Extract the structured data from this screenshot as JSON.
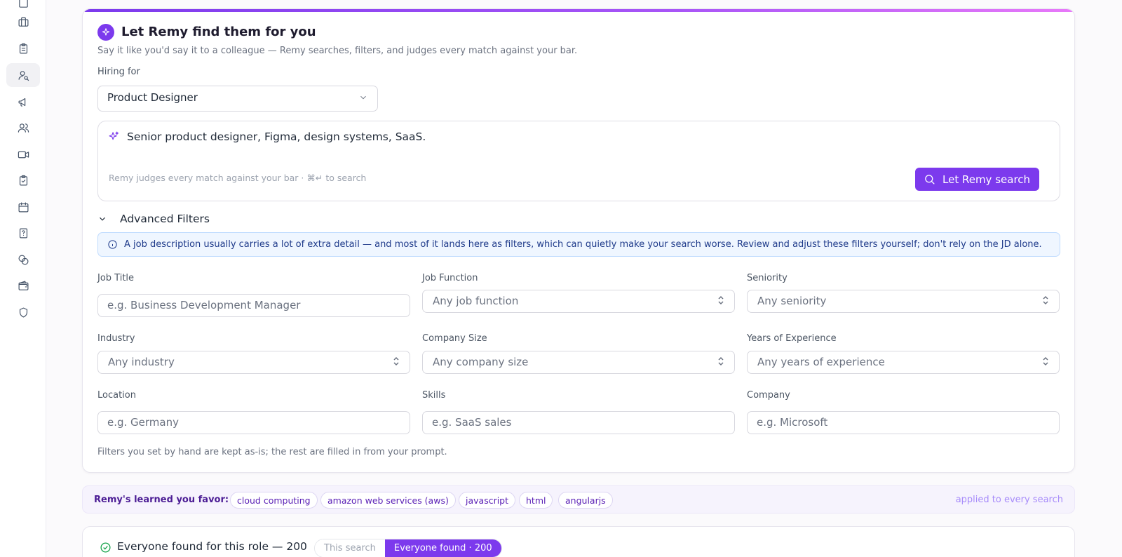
{
  "sidebar": {
    "items": [
      {
        "icon": "briefcase-icon",
        "name": "sidebar-item-jobs"
      },
      {
        "icon": "clipboard-icon",
        "name": "sidebar-item-tasks"
      },
      {
        "icon": "user-search-icon",
        "name": "sidebar-item-sourcing",
        "active": true
      },
      {
        "icon": "megaphone-icon",
        "name": "sidebar-item-campaigns"
      },
      {
        "icon": "users-icon",
        "name": "sidebar-item-candidates"
      },
      {
        "icon": "video-icon",
        "name": "sidebar-item-interviews"
      },
      {
        "icon": "clipboard-check-icon",
        "name": "sidebar-item-assessments"
      },
      {
        "icon": "calendar-icon",
        "name": "sidebar-item-calendar"
      },
      {
        "icon": "help-document-icon",
        "name": "sidebar-item-questions"
      },
      {
        "icon": "coins-icon",
        "name": "sidebar-item-billing"
      },
      {
        "icon": "wallet-icon",
        "name": "sidebar-item-wallet"
      },
      {
        "icon": "shield-icon",
        "name": "sidebar-item-security"
      }
    ]
  },
  "remy": {
    "title": "Let Remy find them for you",
    "subtitle": "Say it like you'd say it to a colleague — Remy searches, filters, and judges every match against your bar.",
    "hiring_label": "Hiring for",
    "hiring_value": "Product Designer",
    "prompt_text": "Senior product designer, Figma, design systems, SaaS.",
    "prompt_hint": "Remy judges every match against your bar · ⌘↵ to search",
    "search_button": "Let Remy search",
    "advanced_label": "Advanced Filters",
    "info_text": "A job description usually carries a lot of extra detail — and most of it lands here as filters, which can quietly make your search worse. Review and adjust these filters yourself; don't rely on the JD alone.",
    "footer_note": "Filters you set by hand are kept as-is; the rest are filled in from your prompt."
  },
  "filters": {
    "job_title": {
      "label": "Job Title",
      "placeholder": "e.g. Business Development Manager"
    },
    "job_function": {
      "label": "Job Function",
      "placeholder": "Any job function"
    },
    "seniority": {
      "label": "Seniority",
      "placeholder": "Any seniority"
    },
    "industry": {
      "label": "Industry",
      "placeholder": "Any industry"
    },
    "company_size": {
      "label": "Company Size",
      "placeholder": "Any company size"
    },
    "experience": {
      "label": "Years of Experience",
      "placeholder": "Any years of experience"
    },
    "location": {
      "label": "Location",
      "placeholder": "e.g. Germany"
    },
    "skills": {
      "label": "Skills",
      "placeholder": "e.g. SaaS sales"
    },
    "company": {
      "label": "Company",
      "placeholder": "e.g. Microsoft"
    }
  },
  "learned": {
    "label": "Remy's learned you favor:",
    "chips": [
      "cloud computing",
      "amazon web services (aws)",
      "javascript",
      "html",
      "angularjs"
    ],
    "right_note": "applied to every search"
  },
  "results": {
    "title": "Everyone found for this role — 200",
    "tab_this_search": "This search",
    "tab_everyone": "Everyone found · 200"
  },
  "colors": {
    "accent": "#7c3aed",
    "info_bg": "#eff6ff",
    "success": "#16a34a"
  }
}
